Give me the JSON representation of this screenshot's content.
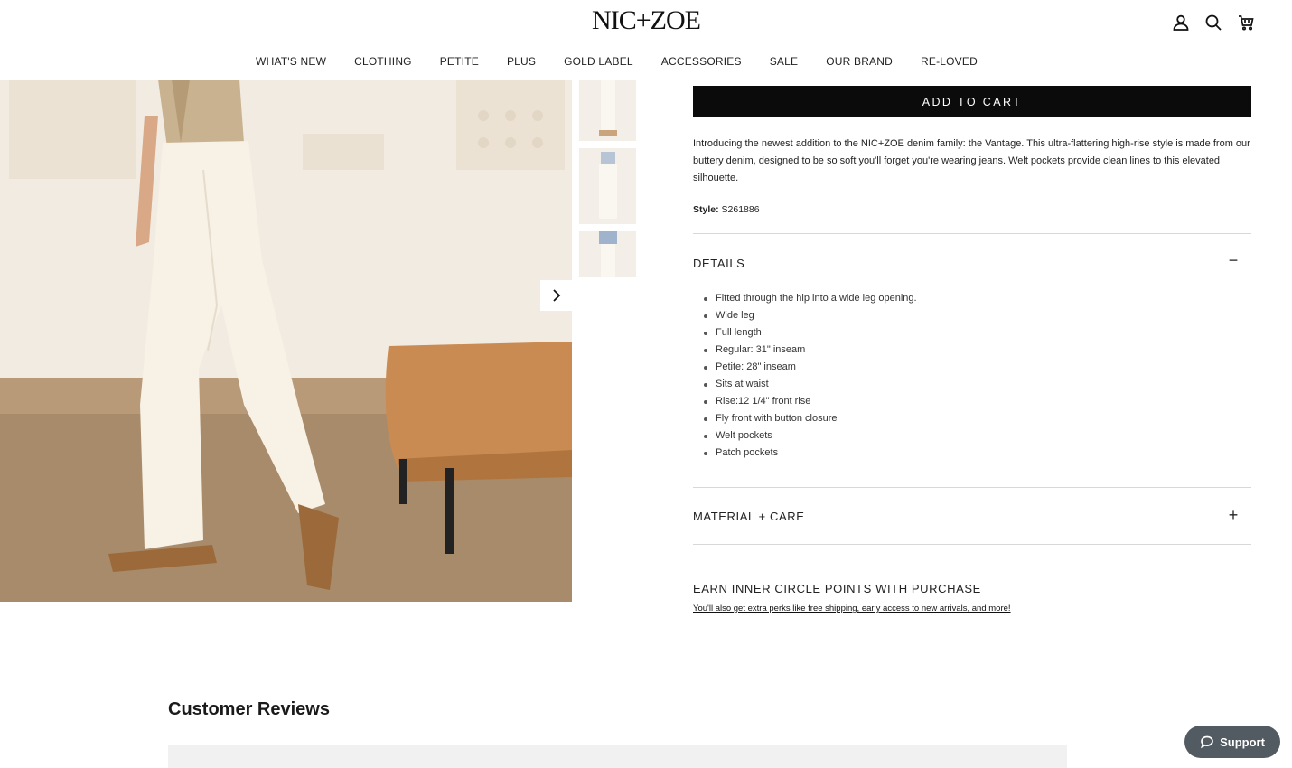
{
  "header": {
    "logo": "NIC+ZOE",
    "icons": [
      "account-icon",
      "search-icon",
      "cart-icon"
    ]
  },
  "nav": {
    "items": [
      "WHAT'S NEW",
      "CLOTHING",
      "PETITE",
      "PLUS",
      "GOLD LABEL",
      "ACCESSORIES",
      "SALE",
      "OUR BRAND",
      "RE-LOVED"
    ]
  },
  "product": {
    "add_to_cart_label": "ADD TO CART",
    "description": "Introducing the newest addition to the NIC+ZOE denim family: the Vantage. This ultra-flattering high-rise style is made from our buttery denim, designed to be so soft you'll forget you're wearing jeans. Welt pockets provide clean lines to this elevated silhouette.",
    "style_label": "Style:",
    "style_value": "S261886"
  },
  "details": {
    "title": "DETAILS",
    "toggle": "−",
    "items": [
      "Fitted through the hip into a wide leg opening.",
      "Wide leg",
      "Full length",
      "Regular: 31\" inseam",
      "Petite: 28\" inseam",
      "Sits at waist",
      "Rise:12 1/4\" front rise",
      "Fly front with button closure",
      "Welt pockets",
      "Patch pockets"
    ]
  },
  "material": {
    "title": "MATERIAL + CARE",
    "toggle": "+"
  },
  "rewards": {
    "title": "EARN INNER CIRCLE POINTS WITH PURCHASE",
    "link": "You'll also get extra perks like free shipping, early access to new arrivals, and more!"
  },
  "reviews": {
    "title": "Customer Reviews"
  },
  "support": {
    "label": "Support"
  },
  "colors": {
    "button_bg": "#0b0b0b",
    "support_bg": "#535b62",
    "divider": "#d8d8d8"
  }
}
